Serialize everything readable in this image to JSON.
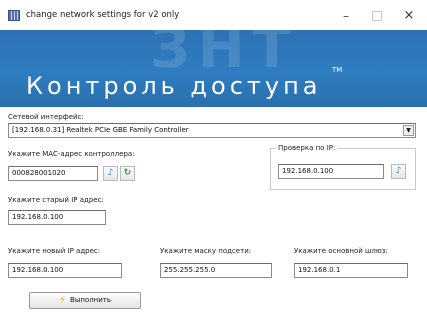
{
  "window": {
    "title": "change network settings for v2 only",
    "minimize_glyph": "–",
    "close_glyph": "×"
  },
  "banner": {
    "watermark": "ЗНТ",
    "title": "Контроль доступа",
    "trademark": "TM"
  },
  "form": {
    "interface_label": "Сетевой интерфейс:",
    "interface_value": "[192.168.0.31] Realtek PCIe GBE Family Controller",
    "mac_label": "Укажите MAC-адрес контроллера:",
    "mac_value": "000828001020",
    "ping_group_label": "Проверка по IP:",
    "ping_ip_value": "192.168.0.100",
    "old_ip_label": "Укажите старый IP адрес:",
    "old_ip_value": "192.168.0.100",
    "new_ip_label": "Укажите новый IP адрес:",
    "new_ip_value": "192.168.0.100",
    "mask_label": "Укажите маску подсети:",
    "mask_value": "255.255.255.0",
    "gateway_label": "Укажите основной шлюз:",
    "gateway_value": "192.168.0.1",
    "execute_label": "Выполнить"
  },
  "icons": {
    "app": "network-settings-icon",
    "note": "♪",
    "refresh": "↻",
    "bolt": "⚡",
    "dropdown": "▼"
  },
  "colors": {
    "banner": "#2e7dc0",
    "bolt": "#f0b000",
    "refresh": "#2e9b39",
    "note": "#2c7bd2"
  }
}
